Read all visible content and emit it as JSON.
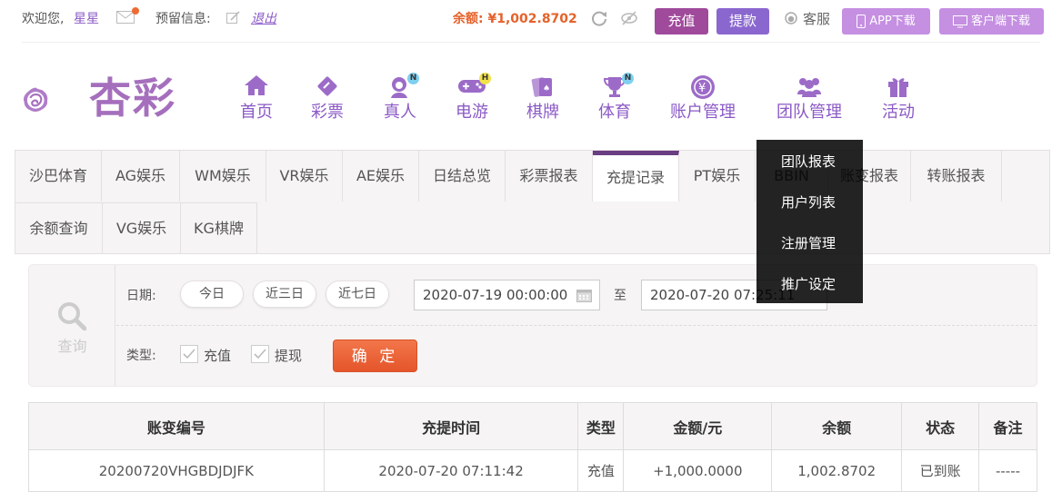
{
  "topbar": {
    "welcome": "欢迎您,",
    "username": "星星",
    "reserve_info": "预留信息:",
    "logout": "退出",
    "balance": "余额: ¥1,002.8702",
    "deposit": "充值",
    "withdraw": "提款",
    "support": "客服",
    "app_download": "APP下载",
    "client_download": "客户端下载",
    "colors": {
      "accent": "#8b59c6",
      "balance": "#e5622a",
      "deposit_bg": "#a04a9b",
      "withdraw_bg": "#8a67cf"
    },
    "icons": [
      "mail-icon",
      "edit-icon",
      "refresh-icon",
      "eye-slash-icon",
      "support-icon",
      "phone-icon",
      "monitor-icon"
    ]
  },
  "logo": {
    "text": "杏彩"
  },
  "nav": [
    {
      "label": "首页",
      "icon": "home-icon",
      "badge": ""
    },
    {
      "label": "彩票",
      "icon": "lottery-icon",
      "badge": ""
    },
    {
      "label": "真人",
      "icon": "live-dealer-icon",
      "badge": "N"
    },
    {
      "label": "电游",
      "icon": "gamepad-icon",
      "badge": "H"
    },
    {
      "label": "棋牌",
      "icon": "cards-icon",
      "badge": ""
    },
    {
      "label": "体育",
      "icon": "trophy-icon",
      "badge": "N"
    },
    {
      "label": "账户管理",
      "icon": "yen-coin-icon",
      "badge": ""
    },
    {
      "label": "团队管理",
      "icon": "team-icon",
      "badge": ""
    },
    {
      "label": "活动",
      "icon": "gift-icon",
      "badge": ""
    }
  ],
  "tabs_row1": [
    "沙巴体育",
    "AG娱乐",
    "WM娱乐",
    "VR娱乐",
    "AE娱乐",
    "日结总览",
    "彩票报表",
    "充提记录",
    "PT娱乐",
    "BBIN",
    "账变报表",
    "转账报表"
  ],
  "tabs_row2": [
    "余额查询",
    "VG娱乐",
    "KG棋牌"
  ],
  "active_tab": "充提记录",
  "dropdown": [
    "团队报表",
    "用户列表",
    "注册管理",
    "推广设定"
  ],
  "filter": {
    "query_label": "查询",
    "date_label": "日期:",
    "quick_ranges": [
      "今日",
      "近三日",
      "近七日"
    ],
    "start_date": "2020-07-19 00:00:00",
    "to": "至",
    "end_date": "2020-07-20 07:25:11",
    "type_label": "类型:",
    "type_deposit": "充值",
    "type_withdraw": "提现",
    "confirm": "确 定"
  },
  "table": {
    "headers": [
      "账变编号",
      "充提时间",
      "类型",
      "金额/元",
      "余额",
      "状态",
      "备注"
    ],
    "rows": [
      [
        "20200720VHGBDJDJFK",
        "2020-07-20 07:11:42",
        "充值",
        "+1,000.0000",
        "1,002.8702",
        "已到账",
        "-----"
      ]
    ]
  }
}
